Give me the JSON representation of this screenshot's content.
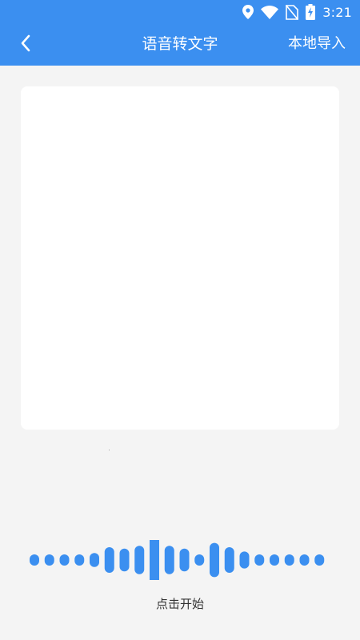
{
  "status_bar": {
    "time": "3:21",
    "icons": [
      "location-icon",
      "wifi-icon",
      "no-sim-icon",
      "battery-charging-icon"
    ]
  },
  "nav": {
    "back_icon": "chevron-left-icon",
    "title": "语音转文字",
    "action_label": "本地导入"
  },
  "transcript": {
    "text": ""
  },
  "recorder": {
    "start_label": "点击开始",
    "bar_levels": [
      0,
      0,
      0,
      0,
      0.1,
      0.5,
      0.4,
      0.6,
      1.0,
      0.6,
      0.4,
      0,
      0.8,
      0.5,
      0.2,
      0,
      0,
      0,
      0,
      0
    ],
    "wave_color": "#3b8ff0"
  },
  "colors": {
    "accent": "#3b8ff0",
    "background": "#f4f4f4",
    "panel": "#ffffff"
  }
}
